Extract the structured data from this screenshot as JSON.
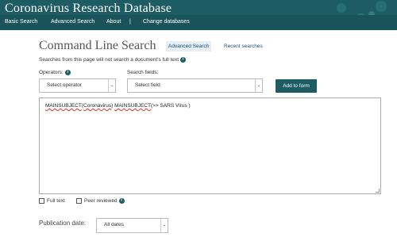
{
  "header": {
    "title": "Coronavirus Research Database",
    "nav": [
      "Basic Search",
      "Advanced Search",
      "About",
      "|",
      "Change databases"
    ]
  },
  "page": {
    "title": "Command Line Search",
    "tabs": {
      "advanced": "Advanced Search",
      "recent": "Recent searches"
    },
    "note": "Searches from this page will not search a document's full text"
  },
  "form": {
    "operators_label": "Operators:",
    "operators_select": "Select operator",
    "fields_label": "Search fields:",
    "fields_select": "Select field",
    "add_button": "Add to form",
    "query": {
      "part1": "MAINSUBJECT(",
      "word1": "Coronavirus",
      "part2": ") MAINSUBJECT(>> SARS Virus )",
      "word2": "MAINSUBJECT",
      "full_after": "(>> SARS Virus )"
    },
    "full_text_label": "Full text",
    "peer_reviewed_label": "Peer reviewed",
    "pub_date_label": "Publication date:",
    "pub_date_select": "All dates"
  },
  "icons": {
    "info": "info-icon",
    "chevron": "chevron-down-icon"
  },
  "colors": {
    "header": "#1d5c63",
    "accent": "#1d5c63",
    "link": "#1a4d7a"
  }
}
